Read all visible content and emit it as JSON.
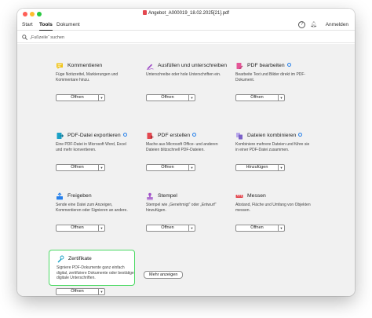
{
  "window": {
    "title": "Angebot_A000019_18.02.2025[21].pdf"
  },
  "menubar": {
    "tabs": [
      "Start",
      "Tools",
      "Dokument"
    ],
    "active_tab": "Tools",
    "sign_in": "Anmelden"
  },
  "search": {
    "placeholder": "„Fußzeile“ suchen"
  },
  "tools": [
    {
      "title": "Kommentieren",
      "desc": "Füge Notizzettel, Markierungen und Kommentare hinzu.",
      "button": "Öffnen",
      "icon": "comment-icon",
      "color": "#f0c419"
    },
    {
      "title": "Ausfüllen und unterschreiben",
      "desc": "Unterschreibe oder hole Unterschriften ein.",
      "button": "Öffnen",
      "icon": "fill-sign-icon",
      "color": "#a050c8"
    },
    {
      "title": "PDF bearbeiten",
      "desc": "Bearbeite Text und Bilder direkt im PDF-Dokument.",
      "button": "Öffnen",
      "icon": "edit-pdf-icon",
      "color": "#e45797",
      "new": true
    },
    {
      "title": "PDF-Datei exportieren",
      "desc": "Eine PDF-Datei in Microsoft Word, Excel und mehr konvertieren.",
      "button": "Öffnen",
      "icon": "export-pdf-icon",
      "color": "#1ba1c6",
      "new": true
    },
    {
      "title": "PDF erstellen",
      "desc": "Mache aus Microsoft Office- und anderen Dateien blitzschnell PDF-Dateien.",
      "button": "Öffnen",
      "icon": "create-pdf-icon",
      "color": "#e34850",
      "new": true
    },
    {
      "title": "Dateien kombinieren",
      "desc": "Kombiniere mehrere Dateien und führe sie in einer PDF-Datei zusammen.",
      "button": "Hinzufügen",
      "icon": "combine-files-icon",
      "color": "#7b61c8",
      "new": true
    },
    {
      "title": "Freigeben",
      "desc": "Sende eine Datei zum Anzeigen, Kommentieren oder Signieren an andere.",
      "button": "Öffnen",
      "icon": "share-icon",
      "color": "#2680eb"
    },
    {
      "title": "Stempel",
      "desc": "Stempel wie „Genehmigt“ oder „Entwurf“ hinzufügen.",
      "button": "Öffnen",
      "icon": "stamp-icon",
      "color": "#a050c8"
    },
    {
      "title": "Messen",
      "desc": "Abstand, Fläche und Umfang von Objekten messen.",
      "button": "Öffnen",
      "icon": "measure-icon",
      "color": "#e34850"
    },
    {
      "title": "Zertifikate",
      "desc": "Signiere PDF-Dokumente ganz einfach digital, zertifiziere Dokumente oder bestätige digitale Unterschriften.",
      "button": "Öffnen",
      "icon": "certificate-icon",
      "color": "#1ba1c6",
      "highlighted": true
    }
  ],
  "more_button": "Mehr anzeigen",
  "colors": {
    "highlight": "#4cd964",
    "new_badge": "#2680eb",
    "content_bg": "#f1f1f1"
  }
}
